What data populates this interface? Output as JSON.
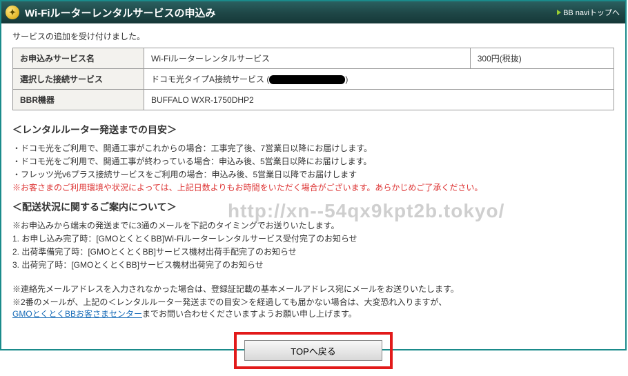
{
  "header": {
    "title": "Wi-Fiルーターレンタルサービスの申込み",
    "nav_link": "BB naviトップへ"
  },
  "confirm_msg": "サービスの追加を受け付けました。",
  "table": {
    "rows": [
      {
        "label": "お申込みサービス名",
        "value": "Wi-Fiルーターレンタルサービス",
        "price": "300円(税抜)"
      },
      {
        "label": "選択した接続サービス",
        "value": "ドコモ光タイプA接続サービス (",
        "redacted": true,
        "tail": ")"
      },
      {
        "label": "BBR機器",
        "value": "BUFFALO WXR-1750DHP2"
      }
    ]
  },
  "section1": {
    "heading": "＜レンタルルーター発送までの目安＞",
    "bullets": [
      "ドコモ光をご利用で、開通工事がこれからの場合：工事完了後、7営業日以降にお届けします。",
      "ドコモ光をご利用で、開通工事が終わっている場合：申込み後、5営業日以降にお届けします。",
      "フレッツ光v6プラス接続サービスをご利用の場合：申込み後、5営業日以降でお届けします"
    ],
    "red_note": "※お客さまのご利用環境や状況によっては、上記日数よりもお時間をいただく場合がございます。あらかじめご了承ください。"
  },
  "section2": {
    "heading": "＜配送状況に関するご案内について＞",
    "intro": "※お申込みから端末の発送までに3通のメールを下記のタイミングでお送りいたします。",
    "items": [
      "1. お申し込み完了時：[GMOとくとくBB]Wi-Fiルーターレンタルサービス受付完了のお知らせ",
      "2. 出荷準備完了時：[GMOとくとくBB]サービス機材出荷手配完了のお知らせ",
      "3. 出荷完了時：[GMOとくとくBB]サービス機材出荷完了のお知らせ"
    ]
  },
  "footnotes": {
    "line1": "※連絡先メールアドレスを入力されなかった場合は、登録証記載の基本メールアドレス宛にメールをお送りいたします。",
    "line2a": "※2番のメールが、上記の＜レンタルルーター発送までの目安＞を経過しても届かない場合は、大変恐れ入りますが、",
    "link": "GMOとくとくBBお客さまセンター",
    "line2b": "までお問い合わせくださいますようお願い申し上げます。"
  },
  "button": {
    "label": "TOPへ戻る"
  },
  "watermark": "http://xn--54qx9kpt2b.tokyo/"
}
